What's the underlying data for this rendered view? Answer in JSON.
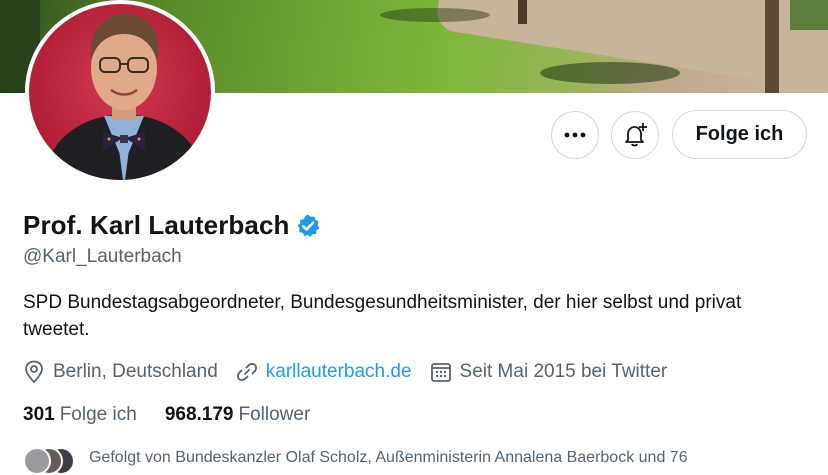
{
  "profile": {
    "name": "Prof. Karl Lauterbach",
    "handle": "@Karl_Lauterbach",
    "bio": "SPD Bundestagsabgeordneter, Bundesgesundheitsminister, der hier selbst und privat tweetet.",
    "location": "Berlin, Deutschland",
    "website": "karllauterbach.de",
    "joined": "Seit Mai 2015 bei Twitter"
  },
  "actions": {
    "more_icon": "more-icon",
    "notify_icon": "bell-plus-icon",
    "follow_label": "Folge ich"
  },
  "stats": {
    "following_count": "301",
    "following_label": "Folge ich",
    "followers_count": "968.179",
    "followers_label": "Follower"
  },
  "followed_by": {
    "text": "Gefolgt von Bundeskanzler Olaf Scholz, Außenministerin Annalena Baerbock und 76"
  },
  "colors": {
    "accent": "#1d9bf0",
    "secondary_text": "#536471",
    "primary_text": "#0f1419",
    "avatar_bg": "#c62a44"
  }
}
